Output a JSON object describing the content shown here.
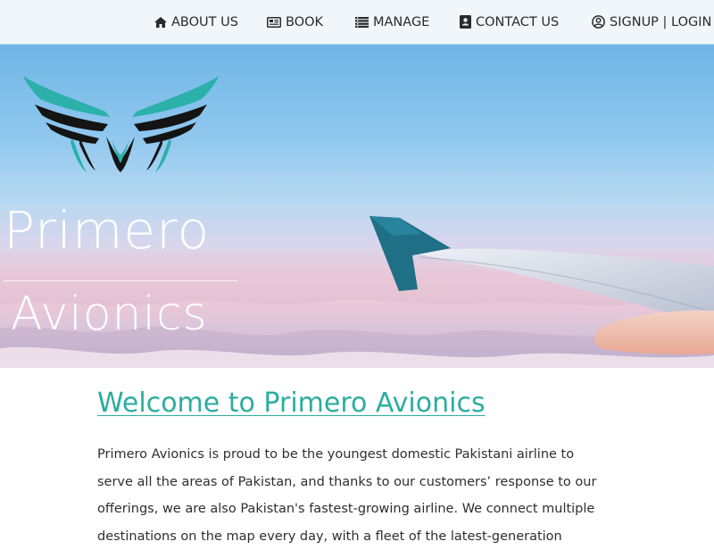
{
  "nav": {
    "items": [
      {
        "label": "ABOUT US",
        "icon": "home-icon"
      },
      {
        "label": "BOOK",
        "icon": "newspaper-icon"
      },
      {
        "label": "MANAGE",
        "icon": "list-icon"
      },
      {
        "label": "CONTACT US",
        "icon": "address-book-icon"
      },
      {
        "label": "SIGNUP | LOGIN",
        "icon": "user-circle-icon"
      }
    ]
  },
  "hero": {
    "brand_line_1": "Primero",
    "brand_line_2": "Avionics"
  },
  "main": {
    "heading": "Welcome to Primero Avionics",
    "paragraph": "Primero Avionics is proud to be the youngest domestic Pakistani airline to serve all the areas of Pakistan, and thanks to our customers’ response to our offerings, we are also Pakistan's fastest-growing airline. We connect multiple destinations on the map every day, with a fleet of the latest-generation"
  },
  "colors": {
    "accent": "#2bada0",
    "logo_teal": "#2bb0aa",
    "nav_background": "#f1f6fa"
  }
}
